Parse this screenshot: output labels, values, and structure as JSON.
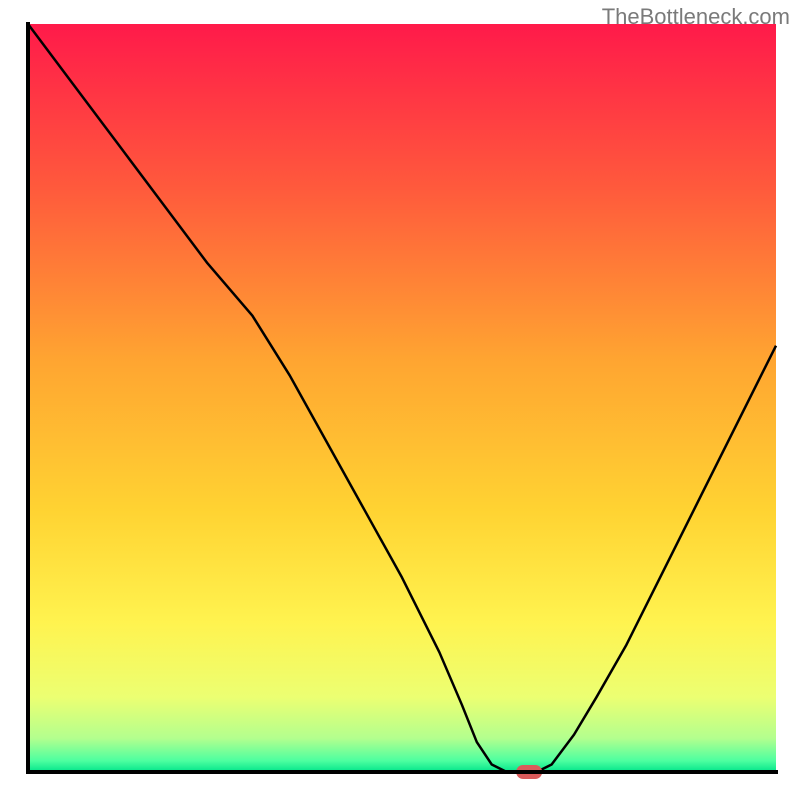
{
  "watermark": "TheBottleneck.com",
  "chart_data": {
    "type": "line",
    "title": "",
    "xlabel": "",
    "ylabel": "",
    "xlim": [
      0,
      100
    ],
    "ylim": [
      0,
      100
    ],
    "curve": [
      {
        "x": 0,
        "y": 100
      },
      {
        "x": 6,
        "y": 92
      },
      {
        "x": 12,
        "y": 84
      },
      {
        "x": 18,
        "y": 76
      },
      {
        "x": 24,
        "y": 68
      },
      {
        "x": 30,
        "y": 61
      },
      {
        "x": 35,
        "y": 53
      },
      {
        "x": 40,
        "y": 44
      },
      {
        "x": 45,
        "y": 35
      },
      {
        "x": 50,
        "y": 26
      },
      {
        "x": 55,
        "y": 16
      },
      {
        "x": 58,
        "y": 9
      },
      {
        "x": 60,
        "y": 4
      },
      {
        "x": 62,
        "y": 1
      },
      {
        "x": 64,
        "y": 0
      },
      {
        "x": 66,
        "y": 0
      },
      {
        "x": 68,
        "y": 0
      },
      {
        "x": 70,
        "y": 1
      },
      {
        "x": 73,
        "y": 5
      },
      {
        "x": 76,
        "y": 10
      },
      {
        "x": 80,
        "y": 17
      },
      {
        "x": 85,
        "y": 27
      },
      {
        "x": 90,
        "y": 37
      },
      {
        "x": 95,
        "y": 47
      },
      {
        "x": 100,
        "y": 57
      }
    ],
    "marker": {
      "x": 67,
      "y": 0,
      "color": "#d95b5b"
    },
    "gradient_stops": [
      {
        "offset": 0.0,
        "color": "#ff1a4a"
      },
      {
        "offset": 0.22,
        "color": "#ff5a3c"
      },
      {
        "offset": 0.45,
        "color": "#ffa531"
      },
      {
        "offset": 0.65,
        "color": "#ffd332"
      },
      {
        "offset": 0.8,
        "color": "#fff34f"
      },
      {
        "offset": 0.9,
        "color": "#ecff72"
      },
      {
        "offset": 0.955,
        "color": "#b3ff8e"
      },
      {
        "offset": 0.985,
        "color": "#4dffa0"
      },
      {
        "offset": 1.0,
        "color": "#00e48a"
      }
    ],
    "axis_color": "#000000",
    "axis_width": 4,
    "curve_color": "#000000",
    "curve_width": 2.5
  }
}
